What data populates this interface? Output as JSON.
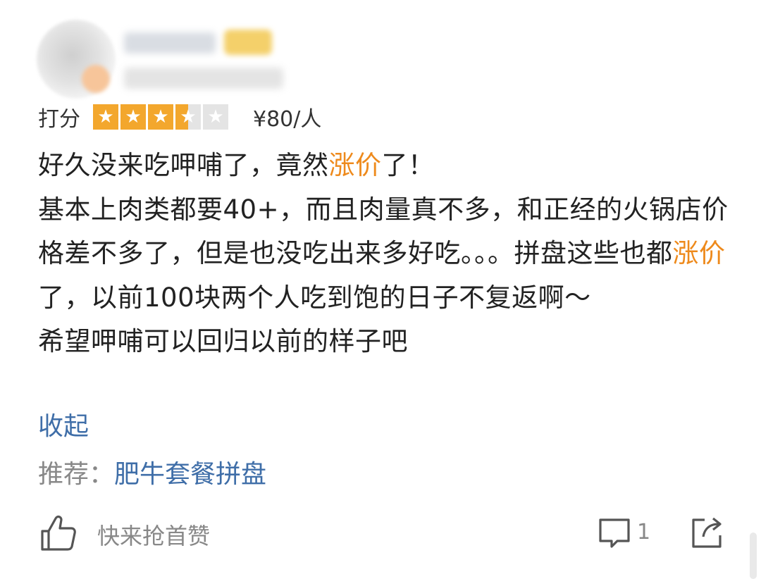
{
  "rating": {
    "label": "打分",
    "stars": [
      {
        "state": "full",
        "glyph": "★"
      },
      {
        "state": "full",
        "glyph": "★"
      },
      {
        "state": "full",
        "glyph": "★"
      },
      {
        "state": "half",
        "glyph": "★"
      },
      {
        "state": "empty",
        "glyph": "★"
      }
    ],
    "score": 3.5,
    "max_score": 5,
    "price": "¥80/人"
  },
  "review": {
    "line1_a": "好久没来吃呷哺了，竟然",
    "line1_hl": "涨价",
    "line1_b": "了！",
    "line2": "基本上肉类都要40+，而且肉量真不多，和正经的火锅店价格差不多了，但是也没吃出来多好吃。。。拼盘这些也都",
    "line2_hl": "涨价",
    "line2_b": "了，以前100块两个人吃到饱的日子不复返啊～",
    "line3": "希望呷哺可以回归以前的样子吧"
  },
  "collapse_label": "收起",
  "recommend": {
    "label": "推荐：",
    "dish": "肥牛套餐拼盘"
  },
  "actions": {
    "like_text": "快来抢首赞",
    "comment_count": "1"
  },
  "colors": {
    "star": "#f3a72d",
    "highlight": "#ee8a1c",
    "link": "#3f6ea8",
    "muted": "#888888"
  }
}
